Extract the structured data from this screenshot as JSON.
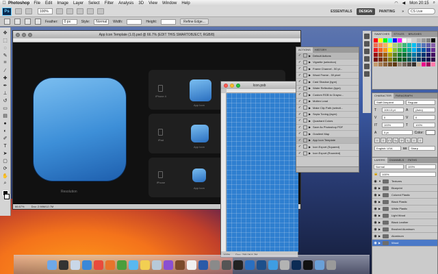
{
  "menubar": {
    "app": "Photoshop",
    "items": [
      "File",
      "Edit",
      "Image",
      "Layer",
      "Select",
      "Filter",
      "Analysis",
      "3D",
      "View",
      "Window",
      "Help"
    ],
    "clock": "Mon 20:15"
  },
  "appbar": {
    "logo": "Ps",
    "zoom": "100%",
    "workspaces": [
      "ESSENTIALS",
      "DESIGN",
      "PAINTING"
    ],
    "active_workspace": "DESIGN",
    "search_label": "CS Live"
  },
  "options": {
    "feather_label": "Feather:",
    "feather_value": "0 px",
    "style_label": "Style:",
    "style_value": "Normal",
    "width_label": "Width:",
    "height_label": "Height:",
    "refine_label": "Refine Edge..."
  },
  "doc": {
    "title": "App Icon Template (1.0).psd @ 66.7% (EDIT THIS SMARTOBJECT, RGB/8)",
    "big_label": "Resolution",
    "devices": [
      "iPhone 4",
      "iPad",
      "iPhone"
    ],
    "small_label": "App Icon",
    "status_zoom": "66.67%",
    "status_doc": "Doc: 2.98M/12.7M"
  },
  "iconwin": {
    "title": "Icon.psb",
    "status_zoom": "100%",
    "status_doc": "Doc: 768.0K/4.2M"
  },
  "actions": {
    "tabs": [
      "ACTIONS",
      "HISTORY"
    ],
    "rows": [
      {
        "label": "Default Actions",
        "type": "set"
      },
      {
        "label": "Vignette (selection)",
        "type": "action"
      },
      {
        "label": "Frame Channel - 50 pi...",
        "type": "action"
      },
      {
        "label": "Wood Frame - 50 pixel",
        "type": "action"
      },
      {
        "label": "Cast Shadow (type)",
        "type": "action"
      },
      {
        "label": "Water Reflection (type)",
        "type": "action"
      },
      {
        "label": "Custom RGB to Graysc...",
        "type": "action"
      },
      {
        "label": "Molten Lead",
        "type": "action"
      },
      {
        "label": "Make Clip Path (selecti...",
        "type": "action"
      },
      {
        "label": "Sepia Toning (layer)",
        "type": "action"
      },
      {
        "label": "Quadrant Colors",
        "type": "action"
      },
      {
        "label": "Save As Photoshop PDF",
        "type": "action"
      },
      {
        "label": "Gradient Map",
        "type": "action"
      },
      {
        "label": "App Icon Template",
        "type": "set"
      },
      {
        "label": "Icon Export (Squared)",
        "type": "action"
      },
      {
        "label": "Icon Export (Rounded)",
        "type": "action"
      }
    ]
  },
  "swatches": {
    "tabs": [
      "SWATCHES",
      "STYLES",
      "BRUSHES"
    ],
    "colors": [
      "#ff0000",
      "#ffff00",
      "#00ff00",
      "#00ffff",
      "#0000ff",
      "#ff00ff",
      "#ffffff",
      "#e6e6e6",
      "#cccccc",
      "#b3b3b3",
      "#999999",
      "#808080",
      "#000000",
      "#f26c4f",
      "#f68e55",
      "#fbaf5c",
      "#fff467",
      "#acd372",
      "#7cc576",
      "#3bb878",
      "#1abbb4",
      "#00bff3",
      "#438ccb",
      "#5574b9",
      "#605ca8",
      "#855fa8",
      "#ed1c24",
      "#f26522",
      "#f7941d",
      "#fff200",
      "#8dc63f",
      "#39b54a",
      "#00a651",
      "#00a99d",
      "#00aeef",
      "#0072bc",
      "#0054a6",
      "#2e3192",
      "#662d91",
      "#9e0b0f",
      "#a0410d",
      "#a36209",
      "#aba000",
      "#598527",
      "#1a7b30",
      "#007236",
      "#00746b",
      "#0076a3",
      "#004b80",
      "#003471",
      "#1b1464",
      "#440e62",
      "#790000",
      "#7b2e00",
      "#7d4900",
      "#827b00",
      "#406618",
      "#005e20",
      "#005826",
      "#005952",
      "#005b7f",
      "#003663",
      "#002157",
      "#0d004c",
      "#32004b",
      "#c69c6d",
      "#a67c52",
      "#8c6239",
      "#754c24",
      "#603913",
      "#998675",
      "#736357",
      "#534741",
      "#362f2d",
      "#c7b299",
      "#ec008c",
      "#9e005d",
      "#ff7bac"
    ]
  },
  "character": {
    "tabs": [
      "CHARACTER",
      "PARAGRAPH"
    ],
    "font": "Staff Dimplent",
    "style": "Regular",
    "size": "108.13 pt",
    "leading": "(Auto)",
    "kerning": "0",
    "tracking": "0",
    "vscale": "100%",
    "hscale": "100%",
    "baseline": "0 pt",
    "color_label": "Color:",
    "language": "English: USA",
    "antialias": "Sharp"
  },
  "layers": {
    "tabs": [
      "LAYERS",
      "CHANNELS",
      "PATHS"
    ],
    "blend": "Normal",
    "opacity": "100%",
    "rows": [
      {
        "label": "Textures",
        "type": "group",
        "selected": false
      },
      {
        "label": "Blueprint",
        "type": "folder",
        "selected": false
      },
      {
        "label": "Colored Plastic",
        "type": "folder",
        "selected": false
      },
      {
        "label": "Black Plastic",
        "type": "folder",
        "selected": false
      },
      {
        "label": "White Plastic",
        "type": "folder",
        "selected": false
      },
      {
        "label": "Light Wood",
        "type": "folder",
        "selected": false
      },
      {
        "label": "Black Leather",
        "type": "folder",
        "selected": false
      },
      {
        "label": "Brushed Aluminum",
        "type": "folder",
        "selected": false
      },
      {
        "label": "Aluminum",
        "type": "folder",
        "selected": false
      },
      {
        "label": "Wood",
        "type": "folder",
        "selected": true
      }
    ]
  },
  "dock": {
    "icons": [
      "finder-icon",
      "dashboard-icon",
      "mail-icon",
      "safari-icon",
      "ical-icon",
      "firefox-icon",
      "chrome-icon",
      "messages-icon",
      "notes-icon",
      "preview-icon",
      "itunes-icon",
      "photos-icon",
      "textedit-icon",
      "word-icon",
      "system-prefs-icon",
      "disk-icon",
      "stats-icon",
      "fetch-icon",
      "xcode-icon",
      "app-store-icon",
      "coda-icon",
      "photoshop-icon",
      "terminal-icon",
      "folder-icon",
      "trash-icon"
    ],
    "colors": [
      "#6fa8e8",
      "#333333",
      "#c9d7e8",
      "#3a88d8",
      "#e94b3c",
      "#e8742b",
      "#4a9e3c",
      "#59b8f0",
      "#f2cf52",
      "#b7c9d9",
      "#8a4fd2",
      "#7b4a2a",
      "#f0f0f0",
      "#2b5aa8",
      "#8a8a8a",
      "#555555",
      "#222222",
      "#2a6fc0",
      "#1d4f8a",
      "#3e9de3",
      "#b3b3b3",
      "#0c2c55",
      "#111111",
      "#6aa0d8",
      "#9a9a9a"
    ]
  }
}
